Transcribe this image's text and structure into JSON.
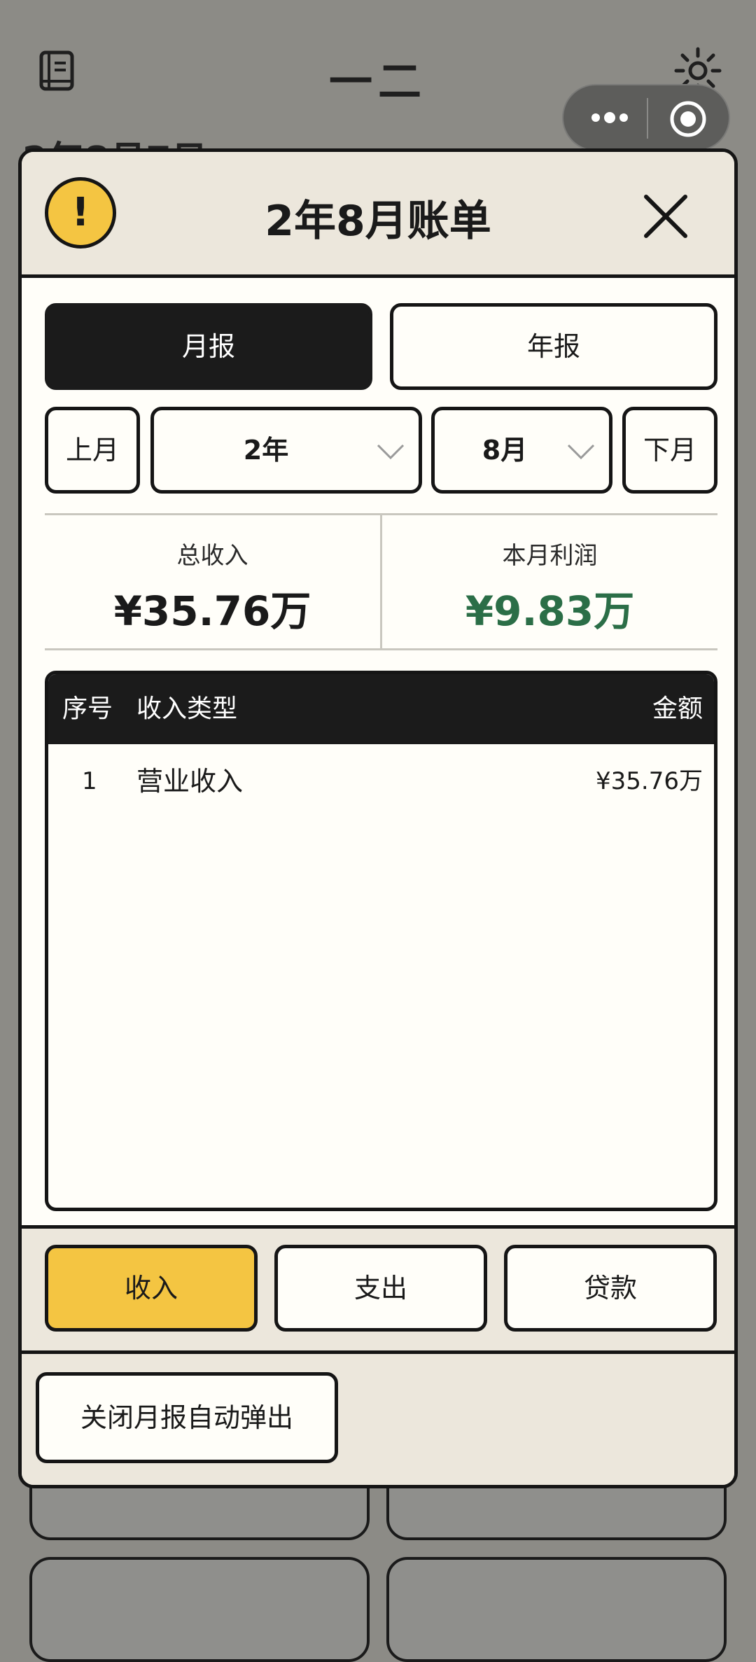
{
  "app": {
    "title": "一二",
    "partial_date": "2年8月7日"
  },
  "modal": {
    "title": "2年8月账单",
    "tabs": [
      {
        "label": "月报",
        "active": true
      },
      {
        "label": "年报",
        "active": false
      }
    ],
    "period": {
      "prev_label": "上月",
      "year_value": "2年",
      "month_value": "8月",
      "next_label": "下月"
    },
    "summary": {
      "income_label": "总收入",
      "income_value": "¥35.76万",
      "profit_label": "本月利润",
      "profit_value": "¥9.83万"
    },
    "table": {
      "headers": [
        "序号",
        "收入类型",
        "金额"
      ],
      "rows": [
        {
          "index": "1",
          "type": "营业收入",
          "amount": "¥35.76万"
        }
      ]
    },
    "category_tabs": [
      {
        "label": "收入",
        "active": true
      },
      {
        "label": "支出",
        "active": false
      },
      {
        "label": "贷款",
        "active": false
      }
    ],
    "auto_popup_button": "关闭月报自动弹出"
  },
  "colors": {
    "accent_yellow": "#f4c542",
    "profit_green": "#2b6e47",
    "dark": "#1b1b1b",
    "cream": "#fffef9",
    "header_beige": "#ece7dc"
  },
  "icons": [
    "book-icon",
    "settings-sun-icon",
    "more-dots-icon",
    "record-icon",
    "alert-icon",
    "close-icon",
    "chevron-down-icon"
  ]
}
